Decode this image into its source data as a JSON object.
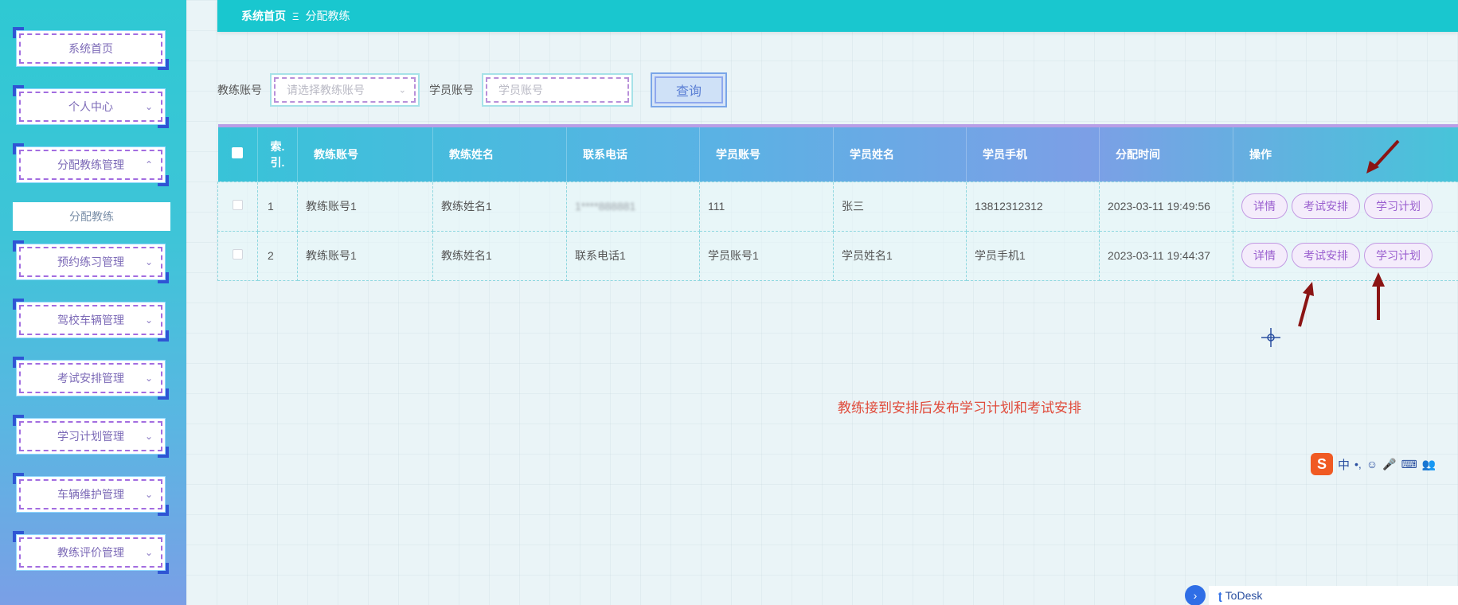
{
  "sidebar": {
    "items": [
      {
        "label": "系统首页",
        "has_chevron": false
      },
      {
        "label": "个人中心",
        "has_chevron": true,
        "chevron": "⌄"
      },
      {
        "label": "分配教练管理",
        "has_chevron": true,
        "chevron": "⌃"
      },
      {
        "label": "预约练习管理",
        "has_chevron": true,
        "chevron": "⌄"
      },
      {
        "label": "驾校车辆管理",
        "has_chevron": true,
        "chevron": "⌄"
      },
      {
        "label": "考试安排管理",
        "has_chevron": true,
        "chevron": "⌄"
      },
      {
        "label": "学习计划管理",
        "has_chevron": true,
        "chevron": "⌄"
      },
      {
        "label": "车辆维护管理",
        "has_chevron": true,
        "chevron": "⌄"
      },
      {
        "label": "教练评价管理",
        "has_chevron": true,
        "chevron": "⌄"
      }
    ],
    "active_sub_item": "分配教练"
  },
  "breadcrumb": {
    "home": "系统首页",
    "separator": "Ξ",
    "current": "分配教练"
  },
  "search": {
    "coach_label": "教练账号",
    "coach_placeholder": "请选择教练账号",
    "student_label": "学员账号",
    "student_placeholder": "学员账号",
    "query_label": "查询"
  },
  "table": {
    "headers": {
      "index_line1": "索",
      "index_line2": "引",
      "coach_account": "教练账号",
      "coach_name": "教练姓名",
      "phone": "联系电话",
      "student_account": "学员账号",
      "student_name": "学员姓名",
      "student_mobile": "学员手机",
      "assign_time": "分配时间",
      "actions": "操作"
    },
    "rows": [
      {
        "index": "1",
        "coach_account": "教练账号1",
        "coach_name": "教练姓名1",
        "phone": "1****888881",
        "student_account": "111",
        "student_name": "张三",
        "student_mobile": "13812312312",
        "assign_time": "2023-03-11 19:49:56"
      },
      {
        "index": "2",
        "coach_account": "教练账号1",
        "coach_name": "教练姓名1",
        "phone": "联系电话1",
        "student_account": "学员账号1",
        "student_name": "学员姓名1",
        "student_mobile": "学员手机1",
        "assign_time": "2023-03-11 19:44:37"
      }
    ],
    "action_labels": {
      "detail": "详情",
      "exam": "考试安排",
      "plan": "学习计划"
    }
  },
  "annotation": "教练接到安排后发布学习计划和考试安排",
  "ime_toolbar": {
    "logo": "S",
    "mode": "中",
    "symbols": [
      "•,",
      "☺",
      "🎤",
      "⌨",
      "👥"
    ]
  },
  "todesk": {
    "tab_glyph": "›",
    "label": "ToDesk"
  },
  "colors": {
    "topbar": "#19c7cf",
    "annotation": "#e04c3c",
    "action_text": "#9a5fcf",
    "arrow": "#8b1414"
  }
}
